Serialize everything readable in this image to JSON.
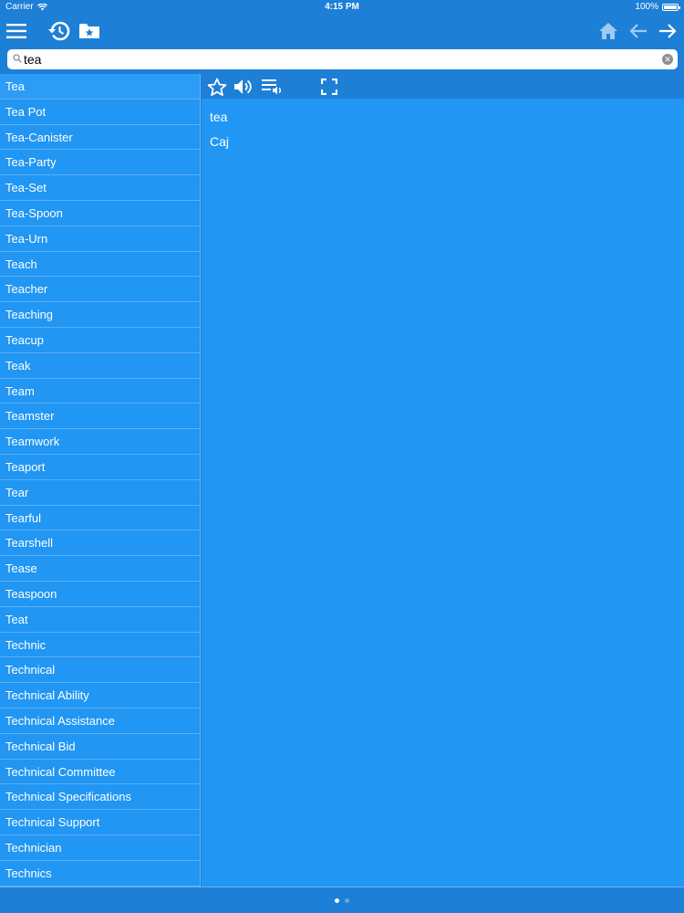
{
  "status_bar": {
    "carrier": "Carrier",
    "time": "4:15 PM",
    "battery": "100%"
  },
  "search": {
    "value": "tea",
    "placeholder": ""
  },
  "words": [
    "Tea",
    "Tea Pot",
    "Tea-Canister",
    "Tea-Party",
    "Tea-Set",
    "Tea-Spoon",
    "Tea-Urn",
    "Teach",
    "Teacher",
    "Teaching",
    "Teacup",
    "Teak",
    "Team",
    "Teamster",
    "Teamwork",
    "Teaport",
    "Tear",
    "Tearful",
    "Tearshell",
    "Tease",
    "Teaspoon",
    "Teat",
    "Technic",
    "Technical",
    "Technical Ability",
    "Technical Assistance",
    "Technical Bid",
    "Technical Committee",
    "Technical Specifications",
    "Technical Support",
    "Technician",
    "Technics"
  ],
  "detail": {
    "word": "tea",
    "translation": "Caj"
  },
  "colors": {
    "toolbar": "#1e7fd6",
    "panel": "#2196f3",
    "divider": "#5ab0f5"
  },
  "icons": {
    "menu": "menu-icon",
    "history": "history-icon",
    "favorites_folder": "favorites-folder-icon",
    "home": "home-icon",
    "back": "arrow-left-icon",
    "forward": "arrow-right-icon",
    "star": "star-icon",
    "speaker": "speaker-icon",
    "playlist": "playlist-audio-icon",
    "fullscreen": "fullscreen-icon"
  },
  "pager": {
    "pages": 2,
    "current": 1
  }
}
